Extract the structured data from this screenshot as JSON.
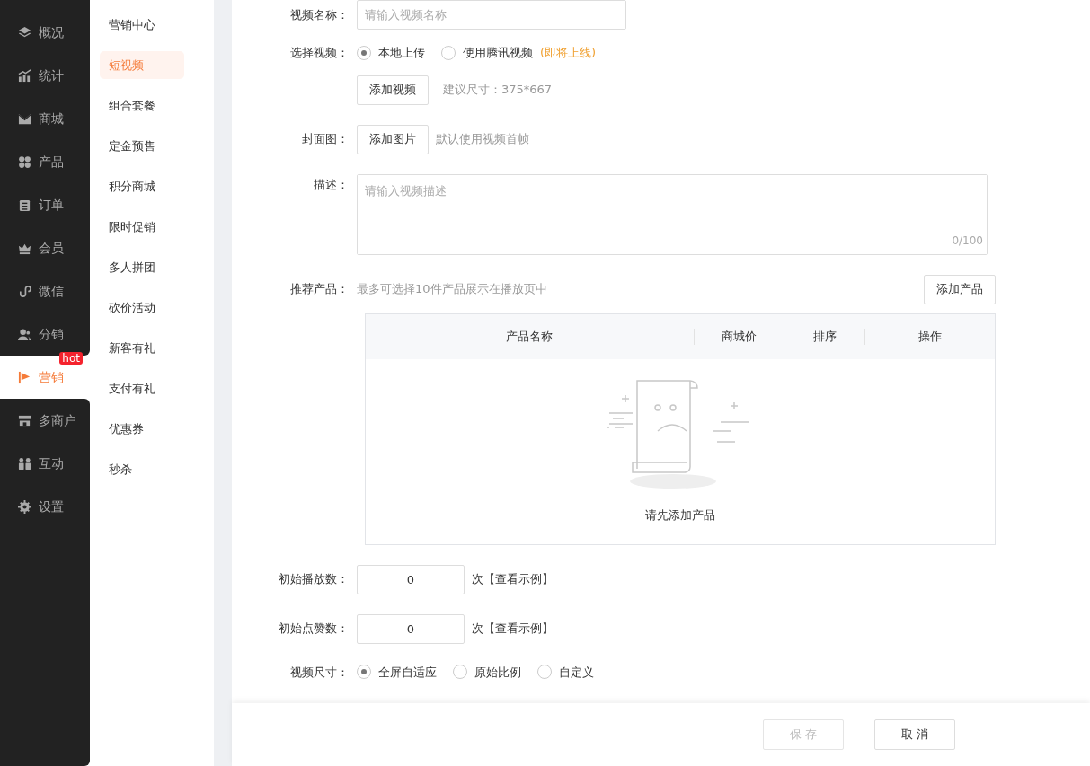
{
  "main_nav": [
    {
      "label": "概况",
      "selected": false
    },
    {
      "label": "统计",
      "selected": false
    },
    {
      "label": "商城",
      "selected": false
    },
    {
      "label": "产品",
      "selected": false
    },
    {
      "label": "订单",
      "selected": false
    },
    {
      "label": "会员",
      "selected": false
    },
    {
      "label": "微信",
      "selected": false
    },
    {
      "label": "分销",
      "selected": false
    },
    {
      "label": "营销",
      "selected": true,
      "badge": "hot"
    },
    {
      "label": "多商户",
      "selected": false
    },
    {
      "label": "互动",
      "selected": false
    },
    {
      "label": "设置",
      "selected": false
    }
  ],
  "sub_nav": [
    {
      "label": "营销中心",
      "selected": false
    },
    {
      "label": "短视频",
      "selected": true
    },
    {
      "label": "组合套餐",
      "selected": false
    },
    {
      "label": "定金预售",
      "selected": false
    },
    {
      "label": "积分商城",
      "selected": false
    },
    {
      "label": "限时促销",
      "selected": false
    },
    {
      "label": "多人拼团",
      "selected": false
    },
    {
      "label": "砍价活动",
      "selected": false
    },
    {
      "label": "新客有礼",
      "selected": false
    },
    {
      "label": "支付有礼",
      "selected": false
    },
    {
      "label": "优惠券",
      "selected": false
    },
    {
      "label": "秒杀",
      "selected": false
    }
  ],
  "form": {
    "video_name": {
      "label": "视频名称：",
      "placeholder": "请输入视频名称"
    },
    "video_source": {
      "label": "选择视频：",
      "options": [
        {
          "label": "本地上传",
          "selected": true
        },
        {
          "label": "使用腾讯视频",
          "selected": false,
          "note": "(即将上线)"
        }
      ],
      "button": "添加视频",
      "hint": "建议尺寸：375*667"
    },
    "cover": {
      "label": "封面图：",
      "button": "添加图片",
      "hint": "默认使用视频首帧"
    },
    "description": {
      "label": "描述：",
      "placeholder": "请输入视频描述",
      "counter": "0/100"
    },
    "products": {
      "label": "推荐产品：",
      "hint": "最多可选择10件产品展示在播放页中",
      "button": "添加产品",
      "columns": [
        "产品名称",
        "商城价",
        "排序",
        "操作"
      ],
      "empty_text": "请先添加产品"
    },
    "play_count": {
      "label": "初始播放数：",
      "value": "0",
      "unit": "次",
      "link": "【查看示例】"
    },
    "like_count": {
      "label": "初始点赞数：",
      "value": "0",
      "unit": "次",
      "link": "【查看示例】"
    },
    "video_size": {
      "label": "视频尺寸：",
      "options": [
        {
          "label": "全屏自适应",
          "selected": true
        },
        {
          "label": "原始比例",
          "selected": false
        },
        {
          "label": "自定义",
          "selected": false
        }
      ]
    }
  },
  "footer": {
    "buttons": [
      {
        "label": "保 存",
        "disabled": true
      },
      {
        "label": "取 消",
        "disabled": false
      }
    ]
  }
}
